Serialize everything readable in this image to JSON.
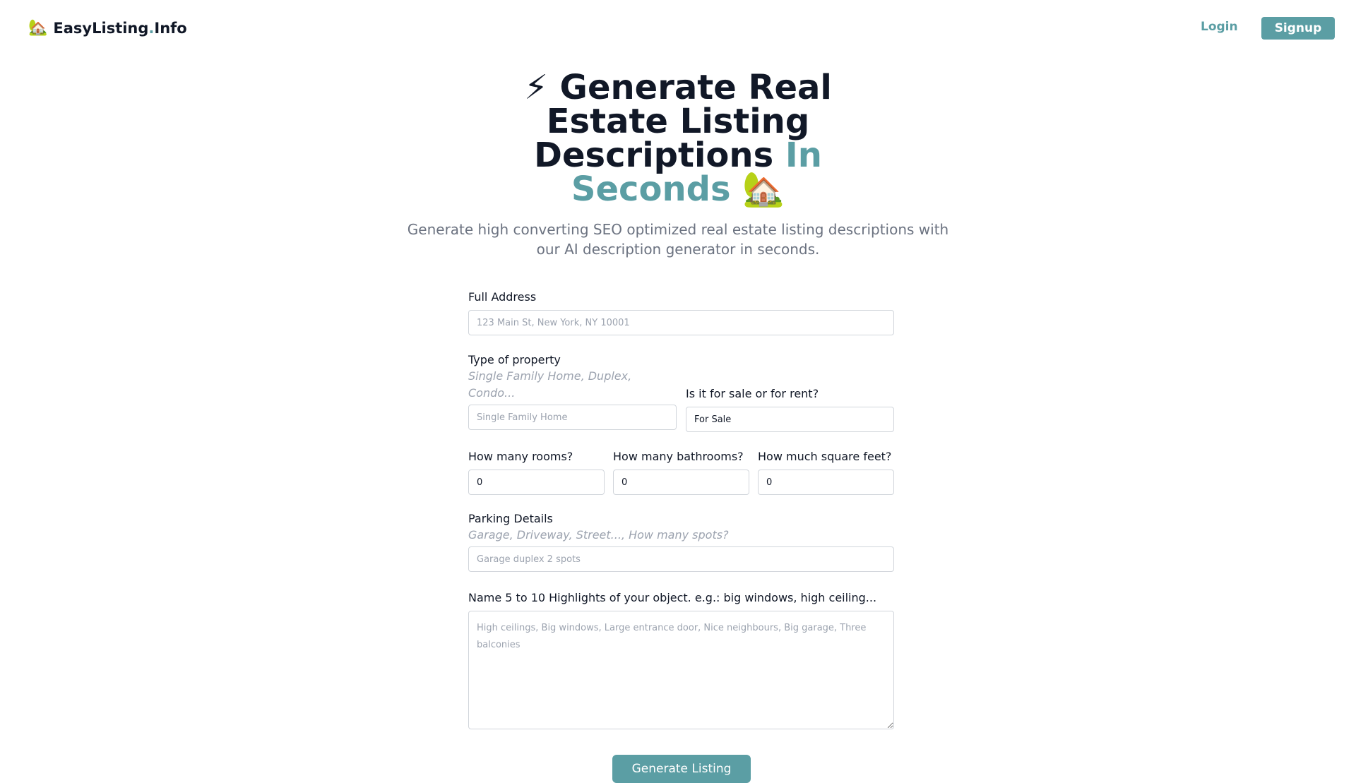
{
  "header": {
    "brand_name": "EasyListing",
    "brand_dot": ".",
    "brand_tld": "Info",
    "brand_icon": "house-with-garden-icon",
    "login_label": "Login",
    "signup_label": "Signup"
  },
  "hero": {
    "title_icon": "⚡",
    "title_main": "Generate Real Estate Listing Descriptions",
    "title_accent": "In Seconds",
    "title_accent_icon": "🏡",
    "subtitle": "Generate high converting SEO optimized real estate listing descriptions with our AI description generator in seconds."
  },
  "form": {
    "address": {
      "label": "Full Address",
      "placeholder": "123 Main St, New York, NY 10001",
      "value": ""
    },
    "property_type": {
      "label": "Type of property",
      "hint": "Single Family Home, Duplex, Condo...",
      "placeholder": "Single Family Home",
      "value": ""
    },
    "sale_or_rent": {
      "label": "Is it for sale or for rent?",
      "value": "For Sale"
    },
    "rooms": {
      "label": "How many rooms?",
      "value": "0"
    },
    "bathrooms": {
      "label": "How many bathrooms?",
      "value": "0"
    },
    "square_feet": {
      "label": "How much square feet?",
      "value": "0"
    },
    "parking": {
      "label": "Parking Details",
      "hint": "Garage, Driveway, Street..., How many spots?",
      "placeholder": "Garage duplex 2 spots",
      "value": ""
    },
    "highlights": {
      "label": "Name 5 to 10 Highlights of your object. e.g.: big windows, high ceiling...",
      "placeholder": "High ceilings, Big windows, Large entrance door, Nice neighbours, Big garage, Three balconies",
      "value": ""
    },
    "submit_label": "Generate Listing"
  },
  "colors": {
    "accent": "#5b9ea4",
    "heading": "#111827",
    "muted": "#6b7280",
    "hint": "#9ca3af"
  }
}
